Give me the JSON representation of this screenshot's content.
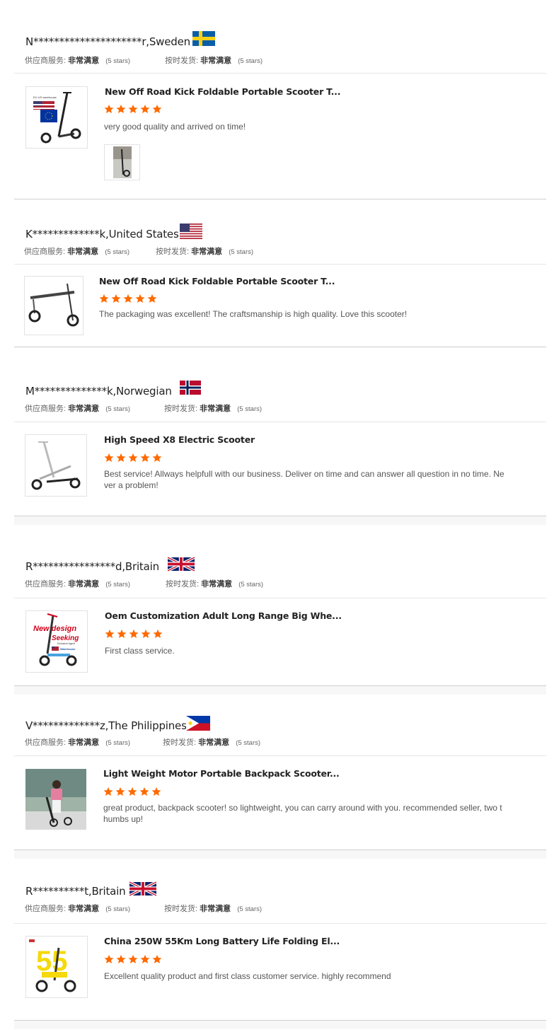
{
  "labels": {
    "supplier_service": "供应商服务:",
    "on_time": "按时发货:",
    "very_satisfied": "非常满意",
    "five_stars": "(5 stars)"
  },
  "colors": {
    "star": "#ff6a00"
  },
  "reviews": [
    {
      "buyer": "N*********************r,Sweden",
      "country": "Sweden",
      "flag_icon": "sweden-flag-icon",
      "product_title": "New Off Road Kick Foldable Portable Scooter T...",
      "rating": 5,
      "comment": "very good quality and arrived on time!",
      "thumb_text": "EU US warehouse",
      "has_attachment": true
    },
    {
      "buyer": "K*************k,United States",
      "country": "United States",
      "flag_icon": "usa-flag-icon",
      "product_title": "New Off Road Kick Foldable Portable Scooter T...",
      "rating": 5,
      "comment": "The packaging was excellent! The craftsmanship is high quality. Love this scooter!",
      "has_attachment": false
    },
    {
      "buyer": "M**************k,Norwegian",
      "country": "Norway",
      "flag_icon": "norway-flag-icon",
      "product_title": "High Speed X8 Electric Scooter",
      "rating": 5,
      "comment": "Best service! Allways helpfull with our business. Deliver on time and can answer all question in no time. Ne ver a problem!",
      "has_attachment": false
    },
    {
      "buyer": "R****************d,Britain",
      "country": "Britain",
      "flag_icon": "uk-flag-icon",
      "product_title": "Oem Customization Adult Long Range Big Whe...",
      "rating": 5,
      "comment": "First class service.",
      "thumb_text_1": "New design",
      "thumb_text_2": "Seeking",
      "thumb_text_3": "Exclusive Agent",
      "thumb_text_4": "Warehouse",
      "has_attachment": false
    },
    {
      "buyer": "V*************z,The Philippines",
      "country": "The Philippines",
      "flag_icon": "philippines-flag-icon",
      "product_title": "Light Weight Motor Portable Backpack Scooter...",
      "rating": 5,
      "comment": "great product, backpack scooter! so lightweight, you can carry around with you. recommended seller, two t humbs up!",
      "has_attachment": false
    },
    {
      "buyer": "R**********t,Britain",
      "country": "Britain",
      "flag_icon": "uk-flag-icon",
      "product_title": "China 250W 55Km Long Battery Life Folding El...",
      "rating": 5,
      "comment": "Excellent quality product and first class customer service. highly recommend",
      "thumb_text": "55",
      "has_attachment": false
    }
  ]
}
